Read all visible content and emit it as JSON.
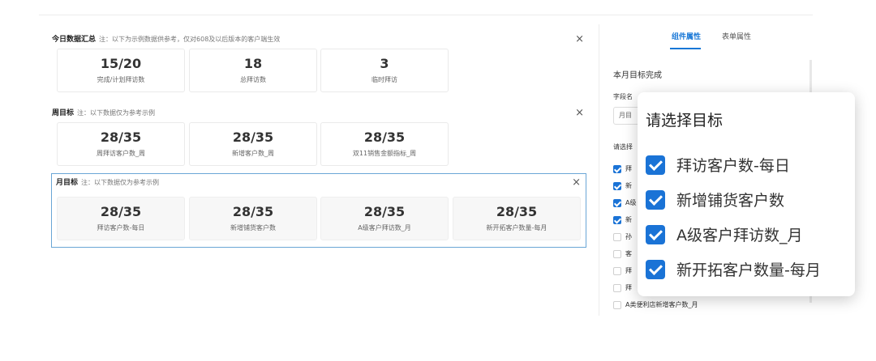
{
  "sections": [
    {
      "title": "今日数据汇总",
      "note": "注：以下为示例数据供参考，仅对608及以后版本的客户端生效",
      "close": "×",
      "cards": [
        {
          "value": "15/20",
          "label": "完成/计划拜访数"
        },
        {
          "value": "18",
          "label": "总拜访数"
        },
        {
          "value": "3",
          "label": "临时拜访"
        }
      ]
    },
    {
      "title": "周目标",
      "note": "注：以下数据仅为参考示例",
      "close": "×",
      "cards": [
        {
          "value": "28/35",
          "label": "周拜访客户数_周"
        },
        {
          "value": "28/35",
          "label": "新增客户数_周"
        },
        {
          "value": "28/35",
          "label": "双11销售金额指标_周"
        }
      ]
    },
    {
      "title": "月目标",
      "note": "注：以下数据仅为参考示例",
      "close": "×",
      "cards": [
        {
          "value": "28/35",
          "label": "拜访客户数-每日"
        },
        {
          "value": "28/35",
          "label": "新增铺货客户数"
        },
        {
          "value": "28/35",
          "label": "A级客户拜访数_月"
        },
        {
          "value": "28/35",
          "label": "新开拓客户数量-每月"
        }
      ]
    }
  ],
  "panel": {
    "tabs": [
      {
        "label": "组件属性",
        "active": true
      },
      {
        "label": "表单属性",
        "active": false
      }
    ],
    "title": "本月目标完成",
    "field_label": "字段名",
    "field_value": "月目",
    "select_label": "请选择",
    "items": [
      {
        "label": "拜",
        "checked": true
      },
      {
        "label": "新",
        "checked": true
      },
      {
        "label": "A级",
        "checked": true
      },
      {
        "label": "新",
        "checked": true
      },
      {
        "label": "孙",
        "checked": false
      },
      {
        "label": "客",
        "checked": false
      },
      {
        "label": "拜",
        "checked": false
      },
      {
        "label": "拜",
        "checked": false
      },
      {
        "label": "A类便利店新增客户数_月",
        "checked": false
      }
    ]
  },
  "popup": {
    "title": "请选择目标",
    "items": [
      {
        "label": "拜访客户数-每日",
        "checked": true
      },
      {
        "label": "新增铺货客户数",
        "checked": true
      },
      {
        "label": "A级客户拜访数_月",
        "checked": true
      },
      {
        "label": "新开拓客户数量-每月",
        "checked": true
      }
    ]
  },
  "colors": {
    "accent": "#1877d6",
    "checkbox": "#1a73d6",
    "selected_border": "#6aa6d6"
  }
}
